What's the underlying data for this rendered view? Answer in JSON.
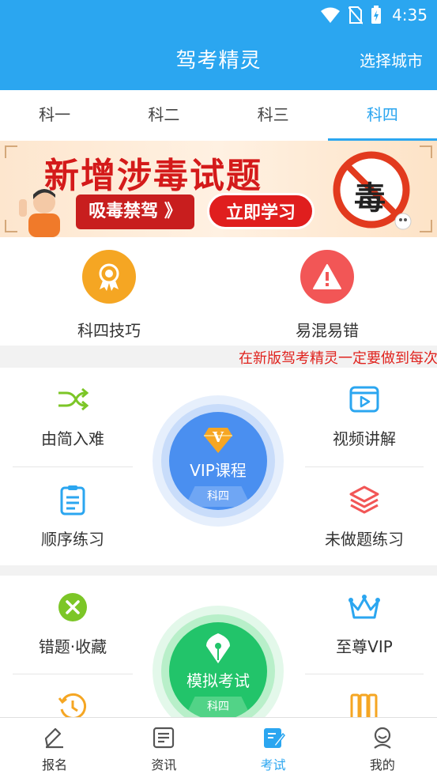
{
  "status_bar": {
    "time": "4:35"
  },
  "header": {
    "title": "驾考精灵",
    "city_button": "选择城市"
  },
  "tabs": [
    {
      "label": "科一"
    },
    {
      "label": "科二"
    },
    {
      "label": "科三"
    },
    {
      "label": "科四",
      "active": true
    }
  ],
  "banner": {
    "title": "新增涉毒试题",
    "tag": "吸毒禁驾 》",
    "cta": "立即学习",
    "badge_char": "毒"
  },
  "tips": [
    {
      "label": "科四技巧",
      "icon": "medal-icon",
      "color": "#f5a623"
    },
    {
      "label": "易混易错",
      "icon": "warning-icon",
      "color": "#f25656"
    }
  ],
  "marquee": {
    "text": "在新版驾考精灵一定要做到每次"
  },
  "section1": {
    "left": [
      {
        "label": "由简入难",
        "icon": "shuffle-icon"
      },
      {
        "label": "顺序练习",
        "icon": "clipboard-icon"
      }
    ],
    "right": [
      {
        "label": "视频讲解",
        "icon": "video-icon"
      },
      {
        "label": "未做题练习",
        "icon": "layers-icon"
      }
    ],
    "center": {
      "label": "VIP课程",
      "sub": "科四",
      "badge": "V"
    }
  },
  "section2": {
    "left": [
      {
        "label": "错题·收藏",
        "icon": "close-circle-icon"
      },
      {
        "label": "",
        "icon": "history-icon"
      }
    ],
    "right": [
      {
        "label": "至尊VIP",
        "icon": "crown-icon"
      },
      {
        "label": "",
        "icon": "books-icon"
      }
    ],
    "center": {
      "label": "模拟考试",
      "sub": "科四"
    }
  },
  "bottom_nav": [
    {
      "label": "报名",
      "icon": "pen-icon"
    },
    {
      "label": "资讯",
      "icon": "news-icon"
    },
    {
      "label": "考试",
      "icon": "exam-icon",
      "active": true
    },
    {
      "label": "我的",
      "icon": "user-icon"
    }
  ],
  "colors": {
    "primary": "#2ba6f0",
    "vip": "#4a8ff0",
    "exam": "#22c46a",
    "alert": "#e0231e"
  }
}
